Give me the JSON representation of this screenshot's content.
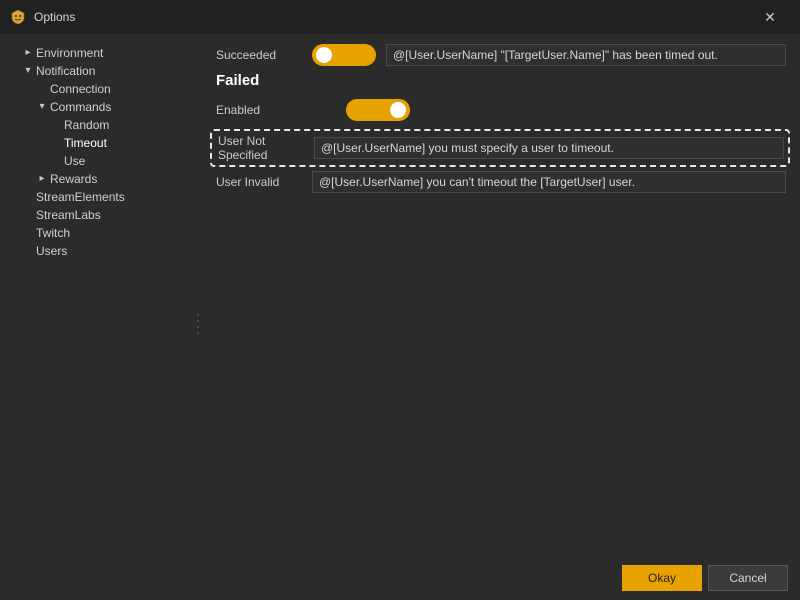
{
  "window": {
    "title": "Options"
  },
  "sidebar": {
    "items": [
      {
        "label": "Environment",
        "expanded": false,
        "hasChildren": true,
        "depth": 0
      },
      {
        "label": "Notification",
        "expanded": true,
        "hasChildren": true,
        "depth": 0
      },
      {
        "label": "Connection",
        "expanded": false,
        "hasChildren": false,
        "depth": 1
      },
      {
        "label": "Commands",
        "expanded": true,
        "hasChildren": true,
        "depth": 1
      },
      {
        "label": "Random",
        "expanded": false,
        "hasChildren": false,
        "depth": 2
      },
      {
        "label": "Timeout",
        "expanded": false,
        "hasChildren": false,
        "depth": 2
      },
      {
        "label": "Use",
        "expanded": false,
        "hasChildren": false,
        "depth": 2
      },
      {
        "label": "Rewards",
        "expanded": false,
        "hasChildren": true,
        "depth": 1
      },
      {
        "label": "StreamElements",
        "expanded": false,
        "hasChildren": false,
        "depth": 0
      },
      {
        "label": "StreamLabs",
        "expanded": false,
        "hasChildren": false,
        "depth": 0
      },
      {
        "label": "Twitch",
        "expanded": false,
        "hasChildren": false,
        "depth": 0
      },
      {
        "label": "Users",
        "expanded": false,
        "hasChildren": false,
        "depth": 0
      }
    ]
  },
  "fields": {
    "succeeded": {
      "label": "Succeeded",
      "value": "@[User.UserName] \"[TargetUser.Name]\" has been timed out."
    },
    "failedHeading": "Failed",
    "enabled": {
      "label": "Enabled"
    },
    "userNotSpecified": {
      "label": "User Not Specified",
      "value": "@[User.UserName] you must specify a user to timeout."
    },
    "userInvalid": {
      "label": "User Invalid",
      "value": "@[User.UserName] you can't timeout the [TargetUser] user."
    }
  },
  "buttons": {
    "ok": "Okay",
    "cancel": "Cancel"
  }
}
